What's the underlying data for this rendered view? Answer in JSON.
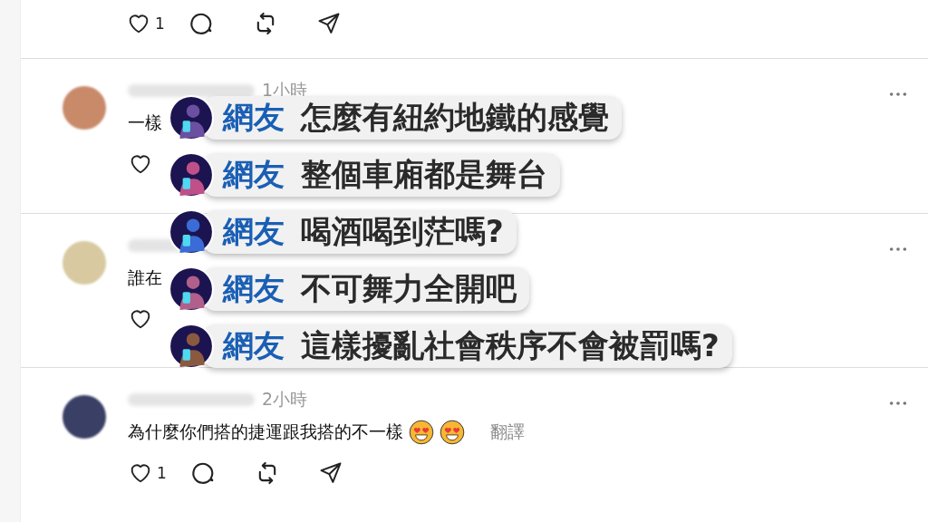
{
  "top_actions": {
    "likes": "1"
  },
  "posts": [
    {
      "time": "1小時",
      "text": "一樣"
    },
    {
      "text": "誰在"
    },
    {
      "time": "2小時",
      "text": "為什麼你們搭的捷運跟我搭的不一樣",
      "likes": "1",
      "translate": "翻譯"
    }
  ],
  "captions": [
    {
      "speaker": "網友",
      "text": "怎麼有紐約地鐵的感覺"
    },
    {
      "speaker": "網友",
      "text": "整個車廂都是舞台"
    },
    {
      "speaker": "網友",
      "text": "喝酒喝到茫嗎?"
    },
    {
      "speaker": "網友",
      "text": "不可舞力全開吧"
    },
    {
      "speaker": "網友",
      "text": "這樣擾亂社會秩序不會被罰嗎?"
    }
  ]
}
